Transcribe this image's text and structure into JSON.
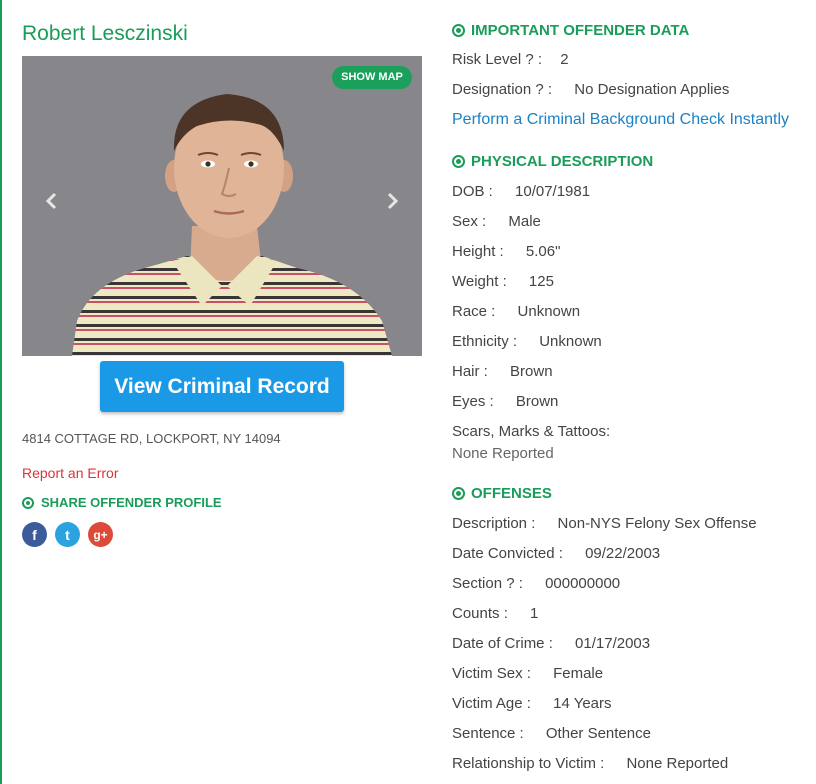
{
  "offender": {
    "name": "Robert Lesczinski",
    "address": "4814 COTTAGE RD, LOCKPORT, NY 14094"
  },
  "photo": {
    "show_map_label": "SHOW MAP",
    "prev_icon": "chevron-left-icon",
    "next_icon": "chevron-right-icon"
  },
  "actions": {
    "view_record_label": "View Criminal Record",
    "report_error_label": "Report an Error"
  },
  "share": {
    "heading": "SHARE OFFENDER PROFILE",
    "icons": [
      {
        "name": "facebook-icon",
        "glyph": "f",
        "color": "#3b5b9a"
      },
      {
        "name": "twitter-icon",
        "glyph": "t",
        "color": "#2aa3de"
      },
      {
        "name": "google-plus-icon",
        "glyph": "g+",
        "color": "#dc4b3a"
      }
    ]
  },
  "important": {
    "heading": "IMPORTANT OFFENDER DATA",
    "risk_label": "Risk Level ? :",
    "risk_value": "2",
    "designation_label": "Designation ? :",
    "designation_value": "No Designation Applies",
    "background_link": "Perform a Criminal Background Check Instantly"
  },
  "physical": {
    "heading": "PHYSICAL DESCRIPTION",
    "fields": [
      {
        "label": "DOB :",
        "value": "10/07/1981"
      },
      {
        "label": "Sex :",
        "value": "Male"
      },
      {
        "label": "Height :",
        "value": "5.06\""
      },
      {
        "label": "Weight :",
        "value": "125"
      },
      {
        "label": "Race :",
        "value": "Unknown"
      },
      {
        "label": "Ethnicity :",
        "value": "Unknown"
      },
      {
        "label": "Hair :",
        "value": "Brown"
      },
      {
        "label": "Eyes :",
        "value": "Brown"
      }
    ],
    "scars_label": "Scars, Marks & Tattoos:",
    "scars_value": "None Reported"
  },
  "offenses": {
    "heading": "OFFENSES",
    "fields": [
      {
        "label": "Description :",
        "value": "Non-NYS Felony Sex Offense"
      },
      {
        "label": "Date Convicted :",
        "value": "09/22/2003"
      },
      {
        "label": "Section ? :",
        "value": "000000000"
      },
      {
        "label": "Counts :",
        "value": "1"
      },
      {
        "label": "Date of Crime :",
        "value": "01/17/2003"
      },
      {
        "label": "Victim Sex :",
        "value": "Female"
      },
      {
        "label": "Victim Age :",
        "value": "14 Years"
      },
      {
        "label": "Sentence :",
        "value": "Other Sentence"
      },
      {
        "label": "Relationship to Victim :",
        "value": "None Reported"
      }
    ]
  },
  "colors": {
    "accent_green": "#1a9c5a",
    "button_blue": "#1a9ae6",
    "link_blue": "#1a82c8",
    "error_red": "#d9343a"
  }
}
